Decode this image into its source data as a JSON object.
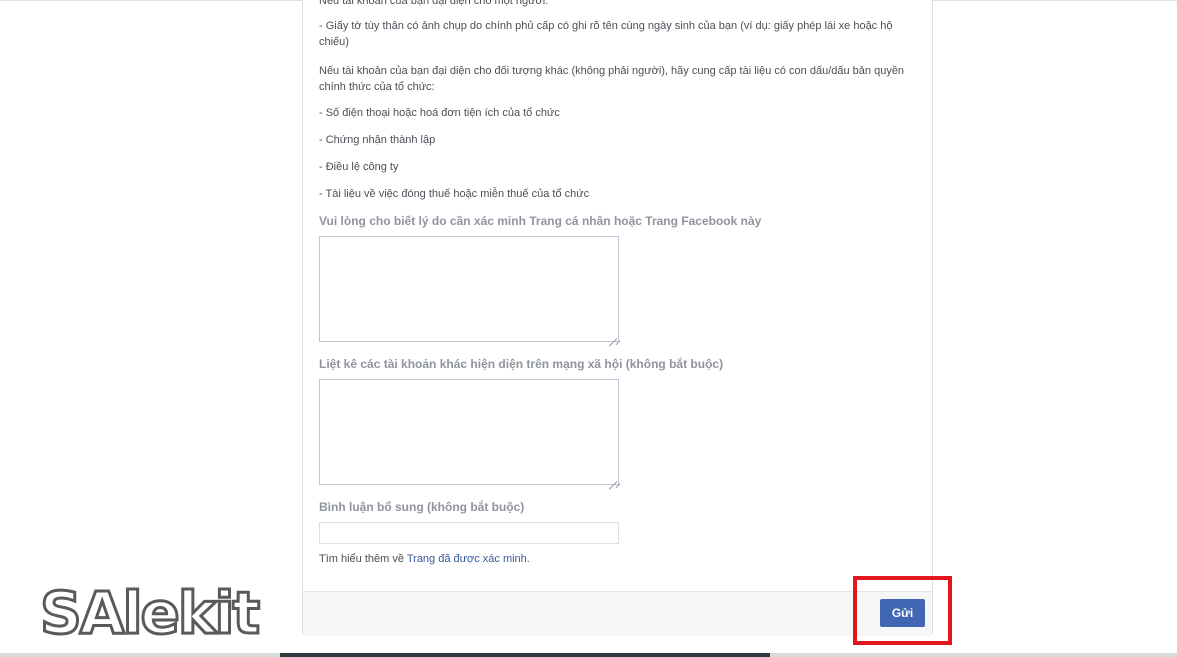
{
  "form": {
    "clipped_line": "Nếu tài khoản của bạn đại diện cho một người:",
    "line_id_doc": "- Giấy tờ tùy thân có ảnh chụp do chính phủ cấp có ghi rõ tên cùng ngày sinh của bạn (ví dụ: giấy phép lái xe hoặc hộ chiếu)",
    "line_org_intro": "Nếu tài khoản của bạn đại diện cho đối tượng khác (không phải người), hãy cung cấp tài liệu có con dấu/dấu bản quyền chính thức của tổ chức:",
    "line_phone_bill": "- Số điện thoại hoặc hoá đơn tiện ích của tổ chức",
    "line_certificate": "- Chứng nhận thành lập",
    "line_charter": "- Điều lệ công ty",
    "line_tax": "- Tài liệu về việc đóng thuế hoặc miễn thuế của tổ chức",
    "reason_label": "Vui lòng cho biết lý do cần xác minh Trang cá nhân hoặc Trang Facebook này",
    "reason_value": "",
    "other_accounts_label": "Liệt kê các tài khoản khác hiện diện trên mạng xã hội (không bắt buộc)",
    "other_accounts_value": "",
    "comment_label": "Bình luận bổ sung (không bắt buộc)",
    "comment_value": "",
    "learn_prefix": "Tìm hiểu thêm về ",
    "learn_link": "Trang đã được xác minh",
    "learn_suffix": "."
  },
  "footer": {
    "send_label": "Gửi"
  },
  "watermark": {
    "text": "SAlekit"
  },
  "colors": {
    "button": "#4267b2",
    "highlight": "#e3161b",
    "link": "#365899"
  }
}
